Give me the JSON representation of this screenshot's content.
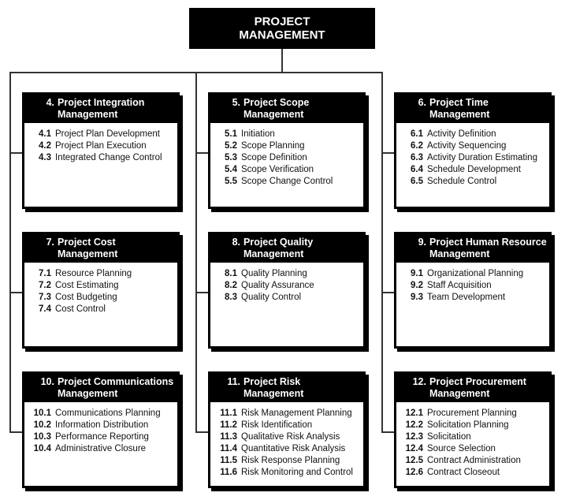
{
  "root": {
    "line1": "PROJECT",
    "line2": "MANAGEMENT"
  },
  "areas": [
    {
      "num": "4.",
      "title": "Project Integration Management",
      "items": [
        [
          "4.1",
          "Project Plan Development"
        ],
        [
          "4.2",
          "Project Plan Execution"
        ],
        [
          "4.3",
          "Integrated Change Control"
        ]
      ]
    },
    {
      "num": "5.",
      "title": "Project Scope Management",
      "items": [
        [
          "5.1",
          "Initiation"
        ],
        [
          "5.2",
          "Scope Planning"
        ],
        [
          "5.3",
          "Scope Definition"
        ],
        [
          "5.4",
          "Scope Verification"
        ],
        [
          "5.5",
          "Scope Change Control"
        ]
      ]
    },
    {
      "num": "6.",
      "title": "Project Time Management",
      "items": [
        [
          "6.1",
          "Activity Definition"
        ],
        [
          "6.2",
          "Activity Sequencing"
        ],
        [
          "6.3",
          "Activity Duration Estimating"
        ],
        [
          "6.4",
          "Schedule Development"
        ],
        [
          "6.5",
          "Schedule Control"
        ]
      ]
    },
    {
      "num": "7.",
      "title": "Project Cost Management",
      "items": [
        [
          "7.1",
          "Resource Planning"
        ],
        [
          "7.2",
          "Cost Estimating"
        ],
        [
          "7.3",
          "Cost Budgeting"
        ],
        [
          "7.4",
          "Cost Control"
        ]
      ]
    },
    {
      "num": "8.",
      "title": "Project Quality Management",
      "items": [
        [
          "8.1",
          "Quality Planning"
        ],
        [
          "8.2",
          "Quality Assurance"
        ],
        [
          "8.3",
          "Quality Control"
        ]
      ]
    },
    {
      "num": "9.",
      "title": "Project Human Resource Management",
      "items": [
        [
          "9.1",
          "Organizational Planning"
        ],
        [
          "9.2",
          "Staff Acquisition"
        ],
        [
          "9.3",
          "Team Development"
        ]
      ]
    },
    {
      "num": "10.",
      "title": "Project Communications Management",
      "items": [
        [
          "10.1",
          "Communications Planning"
        ],
        [
          "10.2",
          "Information Distribution"
        ],
        [
          "10.3",
          "Performance Reporting"
        ],
        [
          "10.4",
          "Administrative Closure"
        ]
      ]
    },
    {
      "num": "11.",
      "title": "Project Risk Management",
      "items": [
        [
          "11.1",
          "Risk Management Planning"
        ],
        [
          "11.2",
          "Risk Identification"
        ],
        [
          "11.3",
          "Qualitative Risk Analysis"
        ],
        [
          "11.4",
          "Quantitative Risk Analysis"
        ],
        [
          "11.5",
          "Risk Response Planning"
        ],
        [
          "11.6",
          "Risk Monitoring and Control"
        ]
      ]
    },
    {
      "num": "12.",
      "title": "Project Procurement Management",
      "items": [
        [
          "12.1",
          "Procurement Planning"
        ],
        [
          "12.2",
          "Solicitation Planning"
        ],
        [
          "12.3",
          "Solicitation"
        ],
        [
          "12.4",
          "Source Selection"
        ],
        [
          "12.5",
          "Contract Administration"
        ],
        [
          "12.6",
          "Contract Closeout"
        ]
      ]
    }
  ]
}
